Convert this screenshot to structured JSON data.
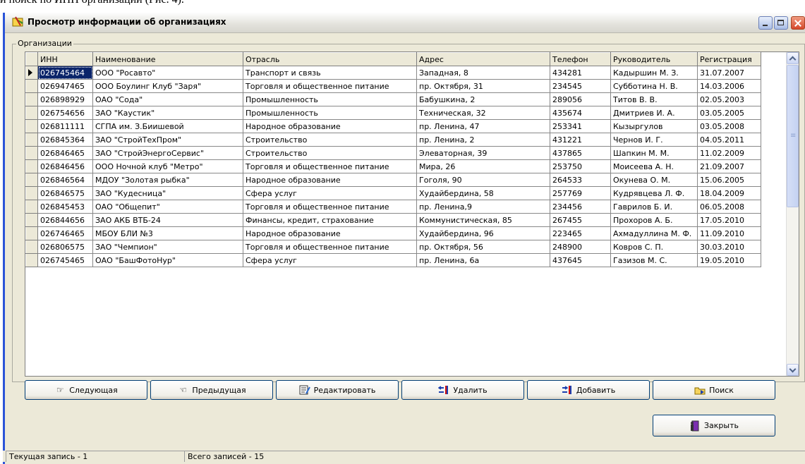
{
  "doc_line": "и поиск по ИНН организации (Рис. 4).",
  "window": {
    "title": "Просмотр информации об организациях"
  },
  "group_caption": "Организации",
  "columns": [
    "ИНН",
    "Наименование",
    "Отрасль",
    "Адрес",
    "Телефон",
    "Руководитель",
    "Регистрация"
  ],
  "rows": [
    [
      "026745464",
      "ООО \"Росавто\"",
      "Транспорт и связь",
      "Западная, 8",
      "434281",
      "Кадыршин М. З.",
      "31.07.2007"
    ],
    [
      "026947465",
      "ООО Боулинг Клуб \"Заря\"",
      "Торговля и общественное питание",
      "пр. Октября, 31",
      "234545",
      "Субботина Н. В.",
      "14.03.2006"
    ],
    [
      "026898929",
      "ОАО \"Сода\"",
      "Промышленность",
      "Бабушкина, 2",
      "289056",
      "Титов В. В.",
      "02.05.2003"
    ],
    [
      "026754656",
      "ЗАО \"Каустик\"",
      "Промышленность",
      "Техническая, 32",
      "435674",
      "Дмитриев И. А.",
      "03.05.2005"
    ],
    [
      "026811111",
      "СГПА им. З.Биишевой",
      "Народное образование",
      "пр. Ленина, 47",
      "253341",
      "Кызыргулов",
      "03.05.2008"
    ],
    [
      "026845364",
      "ЗАО \"СтройТехПром\"",
      "Строительство",
      "пр. Ленина, 2",
      "431221",
      "Чернов И. Г.",
      "04.05.2011"
    ],
    [
      "026846465",
      "ЗАО \"СтройЭнергоСервис\"",
      "Строительство",
      "Элеваторная, 39",
      "437865",
      "Шапкин М. М.",
      "11.02.2009"
    ],
    [
      "026846456",
      "ООО Ночной клуб \"Метро\"",
      "Торговля и общественное питание",
      "Мира, 26",
      "253750",
      "Моисеева А. Н.",
      "21.09.2007"
    ],
    [
      "026846564",
      "МДОУ \"Золотая рыбка\"",
      "Народное образование",
      "Гоголя, 90",
      "264533",
      "Окунева О. М.",
      "15.06.2005"
    ],
    [
      "026846575",
      "ЗАО \"Кудесница\"",
      "Сфера услуг",
      "Худайбердина, 58",
      "257769",
      "Кудрявцева Л. Ф.",
      "18.04.2009"
    ],
    [
      "026845453",
      "ОАО \"Общепит\"",
      "Торговля и общественное питание",
      "пр. Ленина,9",
      "234456",
      "Гаврилов Б. И.",
      "06.05.2008"
    ],
    [
      "026844656",
      "ЗАО АКБ ВТБ-24",
      "Финансы, кредит, страхование",
      "Коммунистическая, 85",
      "267455",
      "Прохоров А. Б.",
      "17.05.2010"
    ],
    [
      "026746465",
      "МБОУ БЛИ №3",
      "Народное образование",
      "Худайбердина, 96",
      "223465",
      "Ахмадуллина М. Ф.",
      "11.09.2010"
    ],
    [
      "026806575",
      "ЗАО \"Чемпион\"",
      "Торговля и общественное питание",
      "пр. Октября, 56",
      "248900",
      "Ковров С. П.",
      "30.03.2010"
    ],
    [
      "026745465",
      "ОАО \"БашФотоНур\"",
      "Сфера услуг",
      "пр. Ленина, 6а",
      "437645",
      "Газизов М. С.",
      "19.05.2010"
    ]
  ],
  "buttons": {
    "next": "Следующая",
    "prev": "Предыдущая",
    "edit": "Редактировать",
    "delete": "Удалить",
    "add": "Добавить",
    "search": "Поиск",
    "close": "Закрыть"
  },
  "icons": {
    "next": "hand-pointing-right-icon",
    "prev": "hand-pointing-left-icon",
    "edit": "edit-document-icon",
    "delete": "delete-record-icon",
    "add": "add-record-icon",
    "search": "search-folder-icon",
    "close": "exit-door-icon"
  },
  "status": {
    "current": "Текущая запись - 1",
    "total": "Всего записей - 15"
  }
}
